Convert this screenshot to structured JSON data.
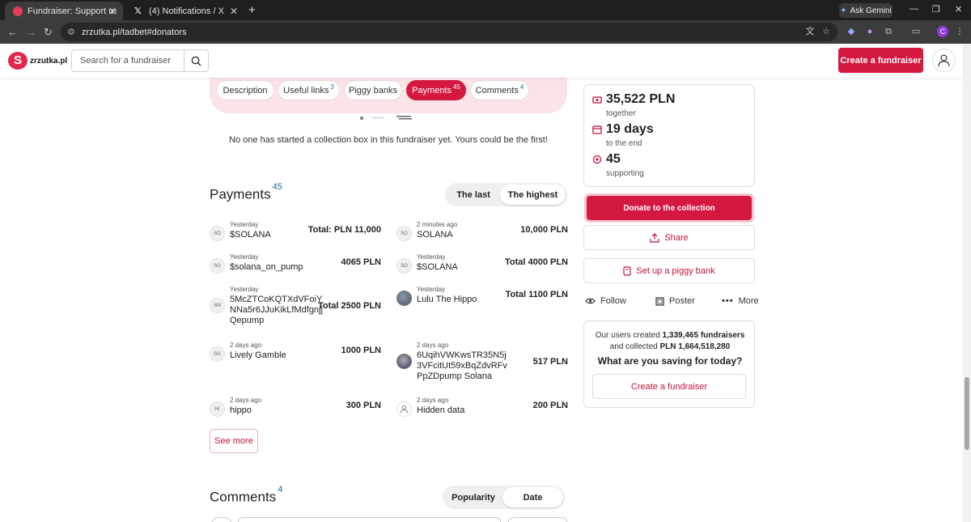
{
  "browser": {
    "tabs": [
      {
        "title": "Fundraiser: Support us and nam",
        "active": true
      },
      {
        "title": "(4) Notifications / X",
        "active": false
      }
    ],
    "ask_gemini": "Ask Gemini",
    "url": "zrzutka.pl/tadbet#donators",
    "profile_initial": "C"
  },
  "header": {
    "logo_text": "zrzutka.pl",
    "search_placeholder": "Search for a fundraiser",
    "create_button": "Create a fundraiser"
  },
  "section_tabs": [
    {
      "label": "Description",
      "count": ""
    },
    {
      "label": "Useful links",
      "count": "3"
    },
    {
      "label": "Piggy banks",
      "count": ""
    },
    {
      "label": "Payments",
      "count": "45",
      "active": true
    },
    {
      "label": "Comments",
      "count": "4"
    }
  ],
  "piggy_empty_note": "No one has started a collection box in this fundraiser yet. Yours could be the first!",
  "payments": {
    "title": "Payments",
    "count": "45",
    "sort_options": [
      "The last",
      "The highest"
    ],
    "selected_sort": "The highest",
    "items": [
      {
        "when": "Yesterday",
        "who": "$SOLANA",
        "amount": "Total: PLN 11,000",
        "avatar": "SO"
      },
      {
        "when": "2 minutes ago",
        "who": "SOLANA",
        "amount": "10,000 PLN",
        "avatar": "SO"
      },
      {
        "when": "Yesterday",
        "who": "$solana_on_pump",
        "amount": "4065 PLN",
        "avatar": "SO"
      },
      {
        "when": "Yesterday",
        "who": "$SOLANA",
        "amount": "Total 4000 PLN",
        "avatar": "SO"
      },
      {
        "when": "Yesterday",
        "who": "5McZTCoKQTXdVFoiYNNa5r6JJuKikLfMdfgnjjQepump",
        "amount": "Total 2500 PLN",
        "avatar": "SM"
      },
      {
        "when": "Yesterday",
        "who": "Lulu The Hippo",
        "amount": "Total 1100 PLN",
        "avatar": ""
      },
      {
        "when": "2 days ago",
        "who": "Lively Gamble",
        "amount": "1000 PLN",
        "avatar": "SG"
      },
      {
        "when": "2 days ago",
        "who": "6UqihVWKwsTR35N5j3VFcitUt59xBqZdvRFvPpZDpump Solana",
        "amount": "517 PLN",
        "avatar": ""
      },
      {
        "when": "2 days ago",
        "who": "hippo",
        "amount": "300 PLN",
        "avatar": "HI"
      },
      {
        "when": "2 days ago",
        "who": "Hidden data",
        "amount": "200 PLN",
        "avatar": ""
      }
    ],
    "see_more": "See more"
  },
  "comments": {
    "title": "Comments",
    "count": "4",
    "sort_options": [
      "Popularity",
      "Date"
    ],
    "selected_sort": "Date"
  },
  "stats": {
    "amount": "35,522 PLN",
    "amount_label": "together",
    "days": "19 days",
    "days_label": "to the end",
    "supporters": "45",
    "supporters_label": "supporting"
  },
  "actions": {
    "donate": "Donate to the collection",
    "share": "Share",
    "piggy": "Set up a piggy bank",
    "follow": "Follow",
    "poster": "Poster",
    "more": "More"
  },
  "promo": {
    "line1_a": "Our users created",
    "fundraisers_count": "1,339,465 fundraisers",
    "line2_a": "and collected",
    "collected": "PLN 1,664,518,280",
    "question": "What are you saving for today?",
    "button": "Create a fundraiser"
  },
  "colors": {
    "brand": "#d5183f",
    "accent_blue": "#1f6d9a",
    "tab_bg": "#fbe3e7"
  }
}
